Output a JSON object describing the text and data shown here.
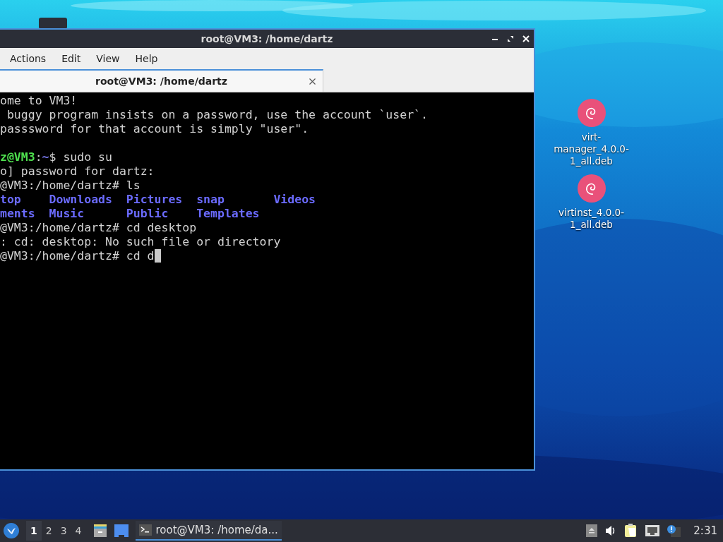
{
  "window": {
    "title": "root@VM3: /home/dartz"
  },
  "menu": [
    "Actions",
    "Edit",
    "View",
    "Help"
  ],
  "tabs": [
    {
      "label": "root@VM3: /home/dartz",
      "selected": true
    }
  ],
  "terminal": {
    "lines": [
      {
        "kind": "text",
        "segments": [
          {
            "kind": "plain",
            "text": "ome to VM3!"
          }
        ]
      },
      {
        "kind": "text",
        "segments": [
          {
            "kind": "plain",
            "text": " buggy program insists on a password, use the account `user`."
          }
        ]
      },
      {
        "kind": "text",
        "segments": [
          {
            "kind": "plain",
            "text": "passsword for that account is simply \"user\"."
          }
        ]
      },
      {
        "kind": "blank"
      },
      {
        "kind": "text",
        "segments": [
          {
            "kind": "user",
            "text": "z@VM3"
          },
          {
            "kind": "plain",
            "text": ":"
          },
          {
            "kind": "path",
            "text": "~"
          },
          {
            "kind": "plain",
            "text": "$ sudo su"
          }
        ]
      },
      {
        "kind": "text",
        "segments": [
          {
            "kind": "plain",
            "text": "o] password for dartz:"
          }
        ]
      },
      {
        "kind": "text",
        "segments": [
          {
            "kind": "plain",
            "text": "@VM3:/home/dartz# ls"
          }
        ]
      },
      {
        "kind": "text",
        "segments": [
          {
            "kind": "dir",
            "text": "top    Downloads  Pictures  snap       Videos"
          }
        ]
      },
      {
        "kind": "text",
        "segments": [
          {
            "kind": "dir",
            "text": "ments  Music      Public    Templates"
          }
        ]
      },
      {
        "kind": "text",
        "segments": [
          {
            "kind": "plain",
            "text": "@VM3:/home/dartz# cd desktop"
          }
        ]
      },
      {
        "kind": "text",
        "segments": [
          {
            "kind": "plain",
            "text": ": cd: desktop: No such file or directory"
          }
        ]
      },
      {
        "kind": "text",
        "segments": [
          {
            "kind": "plain",
            "text": "@VM3:/home/dartz# cd d"
          }
        ],
        "cursor": true
      }
    ]
  },
  "desktop_icons": [
    {
      "label": "virt-manager_4.0.0-1_all.deb"
    },
    {
      "label": "virtinst_4.0.0-1_all.deb"
    }
  ],
  "taskbar": {
    "workspaces": [
      {
        "label": "1",
        "selected": true
      },
      {
        "label": "2",
        "selected": false
      },
      {
        "label": "3",
        "selected": false
      },
      {
        "label": "4",
        "selected": false
      }
    ],
    "tasks": [
      {
        "label": "root@VM3: /home/da...",
        "selected": true
      }
    ],
    "clock": "2:31"
  }
}
